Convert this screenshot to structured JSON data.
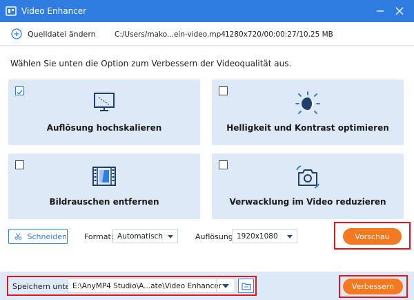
{
  "window": {
    "title": "Video Enhancer",
    "minimize_glyph": "—",
    "close_glyph": "✕"
  },
  "source": {
    "add_label": "Quelldatei ändern",
    "file_path": "C:/Users/mako...ein-video.mp4",
    "file_meta": "1280x720/00:00:27/10,25 MB"
  },
  "instruction": "Wählen Sie unten die Option zum Verbessern der Videoqualität aus.",
  "options": [
    {
      "label": "Auflösung hochskalieren",
      "checked": true,
      "icon": "monitor-upscale-icon"
    },
    {
      "label": "Helligkeit und Kontrast optimieren",
      "checked": false,
      "icon": "brightness-icon"
    },
    {
      "label": "Bildrauschen entfernen",
      "checked": false,
      "icon": "film-denoise-icon"
    },
    {
      "label": "Verwacklung im Video reduzieren",
      "checked": false,
      "icon": "camera-stabilize-icon"
    }
  ],
  "controls": {
    "cut_label": "Schneiden",
    "format_label": "Format:",
    "format_value": "Automatisch",
    "resolution_label": "Auflösung:",
    "resolution_value": "1920x1080",
    "preview_label": "Vorschau"
  },
  "footer": {
    "save_label": "Speichern unter:",
    "save_path": "E:\\AnyMP4 Studio\\A...ate\\Video Enhancer",
    "enhance_label": "Verbessern"
  },
  "colors": {
    "accent": "#2f7de1",
    "card_bg": "#dde9f7",
    "orange": "#f47920",
    "highlight": "#e0141c"
  }
}
